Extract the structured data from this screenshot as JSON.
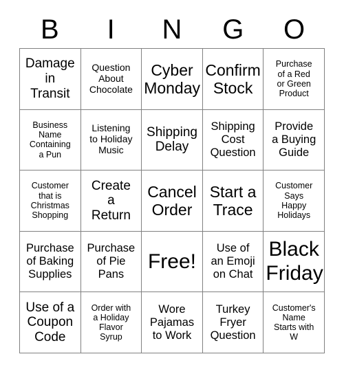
{
  "card": {
    "title": "BINGO",
    "header_letters": [
      "B",
      "I",
      "N",
      "G",
      "O"
    ],
    "columns": 5,
    "rows": 5,
    "border_color": "#808080",
    "text_color": "#000000",
    "background_color": "#ffffff",
    "cells": [
      {
        "text": "Damage\nin\nTransit",
        "size": "lg",
        "free": false
      },
      {
        "text": "Question\nAbout\nChocolate",
        "size": "sm",
        "free": false
      },
      {
        "text": "Cyber\nMonday",
        "size": "xl",
        "free": false
      },
      {
        "text": "Confirm\nStock",
        "size": "xl",
        "free": false
      },
      {
        "text": "Purchase\nof a Red\nor Green\nProduct",
        "size": "xs",
        "free": false
      },
      {
        "text": "Business\nName\nContaining\na Pun",
        "size": "xs",
        "free": false
      },
      {
        "text": "Listening\nto Holiday\nMusic",
        "size": "sm",
        "free": false
      },
      {
        "text": "Shipping\nDelay",
        "size": "lg",
        "free": false
      },
      {
        "text": "Shipping\nCost\nQuestion",
        "size": "md",
        "free": false
      },
      {
        "text": "Provide\na Buying\nGuide",
        "size": "md",
        "free": false
      },
      {
        "text": "Customer\nthat is\nChristmas\nShopping",
        "size": "xs",
        "free": false
      },
      {
        "text": "Create\na\nReturn",
        "size": "lg",
        "free": false
      },
      {
        "text": "Cancel\nOrder",
        "size": "xl",
        "free": false
      },
      {
        "text": "Start a\nTrace",
        "size": "xl",
        "free": false
      },
      {
        "text": "Customer\nSays\nHappy\nHolidays",
        "size": "xs",
        "free": false
      },
      {
        "text": "Purchase\nof Baking\nSupplies",
        "size": "md",
        "free": false
      },
      {
        "text": "Purchase\nof Pie\nPans",
        "size": "md",
        "free": false
      },
      {
        "text": "Free!",
        "size": "xxl",
        "free": true
      },
      {
        "text": "Use of\nan Emoji\non Chat",
        "size": "md",
        "free": false
      },
      {
        "text": "Black\nFriday",
        "size": "xxl",
        "free": false
      },
      {
        "text": "Use of a\nCoupon\nCode",
        "size": "lg",
        "free": false
      },
      {
        "text": "Order with\na Holiday\nFlavor\nSyrup",
        "size": "xs",
        "free": false
      },
      {
        "text": "Wore\nPajamas\nto Work",
        "size": "md",
        "free": false
      },
      {
        "text": "Turkey\nFryer\nQuestion",
        "size": "md",
        "free": false
      },
      {
        "text": "Customer's\nName\nStarts with\nW",
        "size": "xs",
        "free": false
      }
    ]
  }
}
